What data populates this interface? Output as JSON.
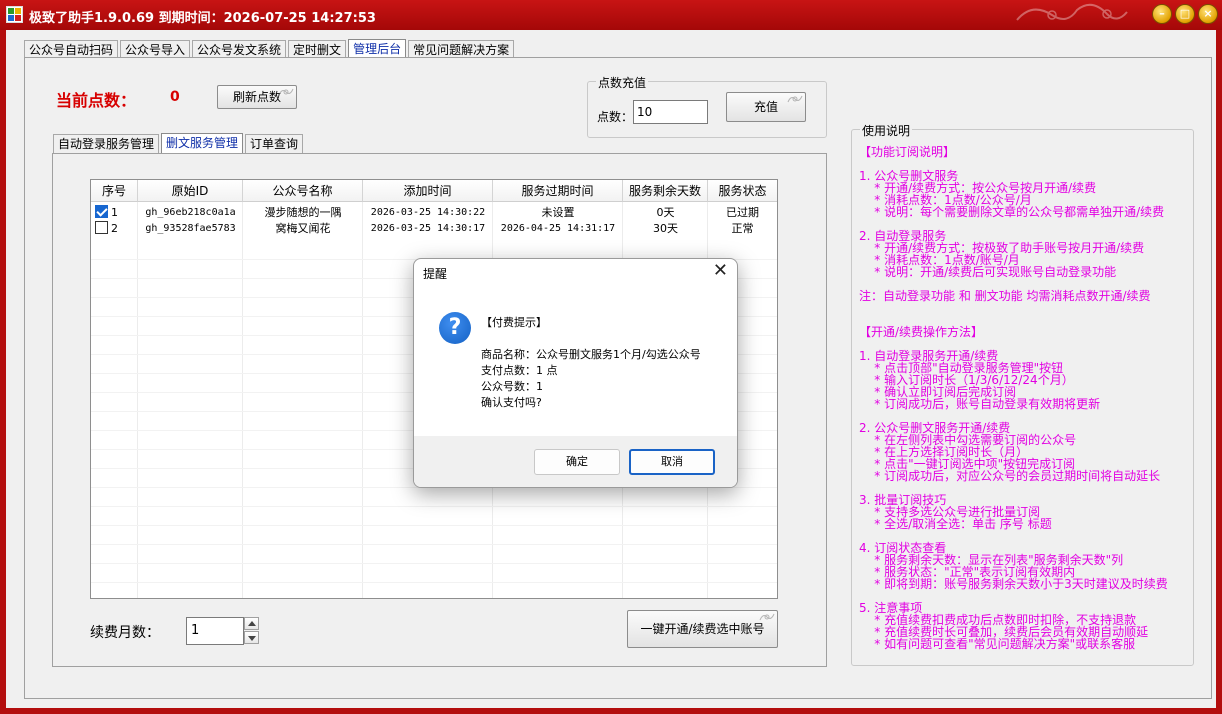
{
  "window": {
    "title": "极致了助手1.9.0.69 到期时间：2026-07-25 14:27:53",
    "minimize_glyph": "–",
    "maximize_glyph": "□",
    "close_glyph": "×"
  },
  "main_tabs": [
    {
      "label": "公众号自动扫码",
      "active": false
    },
    {
      "label": "公众号导入",
      "active": false
    },
    {
      "label": "公众号发文系统",
      "active": false
    },
    {
      "label": "定时删文",
      "active": false
    },
    {
      "label": "管理后台",
      "active": true
    },
    {
      "label": "常见问题解决方案",
      "active": false
    }
  ],
  "points": {
    "label": "当前点数：",
    "value": "0",
    "refresh_label": "刷新点数"
  },
  "recharge": {
    "group_label": "点数充值",
    "field_label": "点数：",
    "field_value": "10",
    "button_label": "充值"
  },
  "sub_tabs": [
    {
      "label": "自动登录服务管理",
      "active": false
    },
    {
      "label": "删文服务管理",
      "active": true
    },
    {
      "label": "订单查询",
      "active": false
    }
  ],
  "table": {
    "columns": [
      "序号",
      "原始ID",
      "公众号名称",
      "添加时间",
      "服务过期时间",
      "服务剩余天数",
      "服务状态"
    ],
    "rows": [
      {
        "checked": true,
        "index": "1",
        "raw_id": "gh_96eb218c0a1a",
        "name": "漫步随想的一隅",
        "added": "2026-03-25 14:30:22",
        "expires": "未设置",
        "remaining": "0天",
        "status": "已过期"
      },
      {
        "checked": false,
        "index": "2",
        "raw_id": "gh_93528fae5783",
        "name": "窝梅又闻花",
        "added": "2026-03-25 14:30:17",
        "expires": "2026-04-25 14:31:17",
        "remaining": "30天",
        "status": "正常"
      }
    ]
  },
  "renew": {
    "label": "续费月数：",
    "value": "1",
    "button_label": "一键开通/续费选中账号"
  },
  "help": {
    "group_label": "使用说明",
    "text": "【功能订阅说明】\n\n1. 公众号删文服务\n    * 开通/续费方式：按公众号按月开通/续费\n    * 消耗点数：1点数/公众号/月\n    * 说明：每个需要删除文章的公众号都需单独开通/续费\n\n2. 自动登录服务\n    * 开通/续费方式：按极致了助手账号按月开通/续费\n    * 消耗点数：1点数/账号/月\n    * 说明：开通/续费后可实现账号自动登录功能\n\n注：自动登录功能 和 删文功能 均需消耗点数开通/续费\n\n\n【开通/续费操作方法】\n\n1. 自动登录服务开通/续费\n    * 点击顶部\"自动登录服务管理\"按钮\n    * 输入订阅时长（1/3/6/12/24个月）\n    * 确认立即订阅后完成订阅\n    * 订阅成功后，账号自动登录有效期将更新\n\n2. 公众号删文服务开通/续费\n    * 在左侧列表中勾选需要订阅的公众号\n    * 在上方选择订阅时长（月）\n    * 点击\"一键订阅选中项\"按钮完成订阅\n    * 订阅成功后，对应公众号的会员过期时间将自动延长\n\n3. 批量订阅技巧\n    * 支持多选公众号进行批量订阅\n    * 全选/取消全选：单击 序号 标题\n\n4. 订阅状态查看\n    * 服务剩余天数：显示在列表\"服务剩余天数\"列\n    * 服务状态：\"正常\"表示订阅有效期内\n    * 即将到期：账号服务剩余天数小于3天时建议及时续费\n\n5. 注意事项\n    * 充值续费扣费成功后点数即时扣除，不支持退款\n    * 充值续费时长可叠加，续费后会员有效期自动顺延\n    * 如有问题可查看\"常见问题解决方案\"或联系客服"
  },
  "dialog": {
    "title": "提醒",
    "close_glyph": "✕",
    "icon_glyph": "?",
    "heading": "【付费提示】",
    "lines": [
      "商品名称：公众号删文服务1个月/勾选公众号",
      "支付点数：1 点",
      "公众号数：1",
      "确认支付吗?"
    ],
    "ok_label": "确定",
    "cancel_label": "取消"
  }
}
